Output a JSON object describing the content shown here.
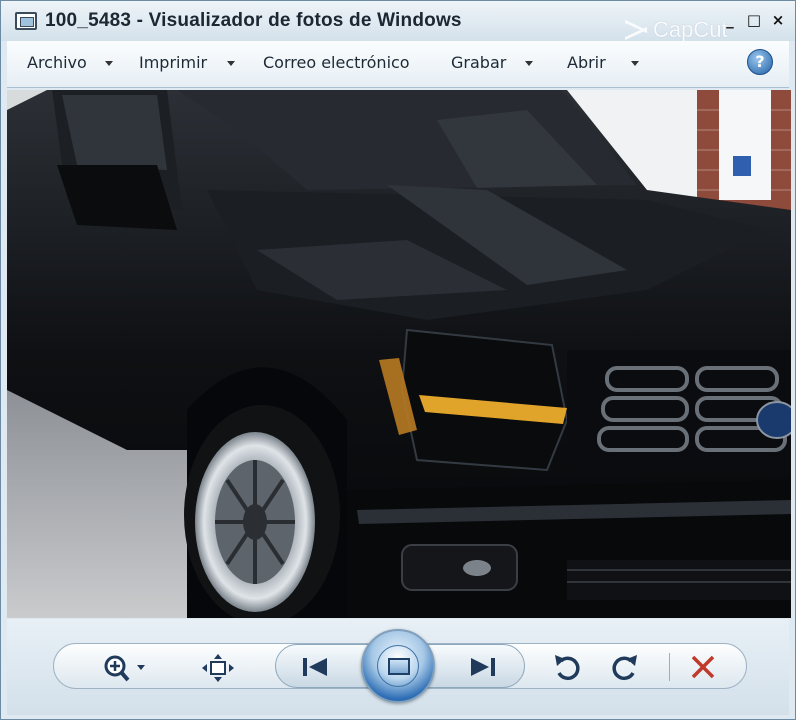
{
  "window": {
    "title": "100_5483 - Visualizador de fotos de Windows",
    "watermark": "CapCut",
    "controls": {
      "minimize": "_",
      "maximize": "□",
      "close": "×"
    }
  },
  "menu": {
    "items": [
      {
        "label": "Archivo",
        "has_arrow": true
      },
      {
        "label": "Imprimir",
        "has_arrow": true
      },
      {
        "label": "Correo electrónico",
        "has_arrow": false
      },
      {
        "label": "Grabar",
        "has_arrow": true
      },
      {
        "label": "Abrir",
        "has_arrow": true
      }
    ],
    "help_label": "?"
  },
  "photo": {
    "subject": "black pickup truck front three-quarter view"
  },
  "toolbar": {
    "buttons": [
      {
        "name": "zoom-button",
        "icon": "magnifier-plus-icon"
      },
      {
        "name": "fit-window-button",
        "icon": "fit-window-icon"
      },
      {
        "name": "previous-button",
        "icon": "skip-previous-icon"
      },
      {
        "name": "slideshow-button",
        "icon": "slideshow-icon"
      },
      {
        "name": "next-button",
        "icon": "skip-next-icon"
      },
      {
        "name": "rotate-left-button",
        "icon": "rotate-counterclockwise-icon"
      },
      {
        "name": "rotate-right-button",
        "icon": "rotate-clockwise-icon"
      },
      {
        "name": "delete-button",
        "icon": "delete-x-icon"
      }
    ],
    "colors": {
      "icon": "#1f3a5a",
      "delete": "#c0392b",
      "accent": "#2f6fb6"
    }
  }
}
